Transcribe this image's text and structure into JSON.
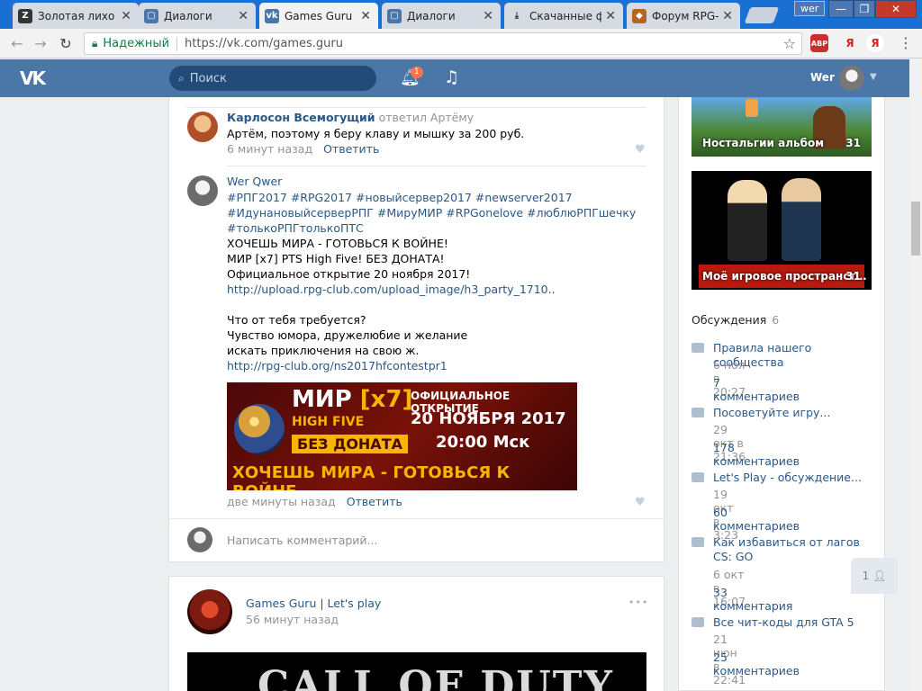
{
  "browser": {
    "tabs": [
      {
        "label": "Золотая лихо",
        "icon": "z-icon",
        "active": false
      },
      {
        "label": "Диалоги",
        "icon": "vk-chat-icon",
        "active": false
      },
      {
        "label": "Games Guru |",
        "icon": "vk-icon",
        "active": true
      },
      {
        "label": "Диалоги",
        "icon": "vk-chat-icon",
        "active": false
      },
      {
        "label": "Скачанные ф",
        "icon": "download-icon",
        "active": false
      },
      {
        "label": "Форум RPG-C",
        "icon": "forum-icon",
        "active": false
      }
    ],
    "profile_name": "wer",
    "secure_label": "Надежный",
    "url": "https://vk.com/games.guru",
    "extensions": [
      {
        "label": "ABP",
        "sub": "2"
      },
      {
        "label": "Я"
      },
      {
        "label": "Я"
      }
    ]
  },
  "vk_header": {
    "logo": "VK",
    "search_placeholder": "Поиск",
    "notifications_count": "1",
    "user_name": "Wer"
  },
  "comments": [
    {
      "author": "Карлосон Всемогущий",
      "replied": "ответил Артёму",
      "text": "Артём, поэтому я беру клаву и мышку за 200 руб.",
      "time": "6 минут назад",
      "reply_label": "Ответить"
    },
    {
      "author": "Wer Qwer",
      "hashtags_line1": "#РПГ2017 #RPG2017 #новыйсервер2017 #newserver2017",
      "hashtags_line2": "#ИдунановыйсерверРПГ #МируМИР #RPGonelove #люблюРПГшечку",
      "hashtags_line3": "#толькоРПГтолькоПТС",
      "line1": "ХОЧЕШЬ МИРА - ГОТОВЬСЯ К ВОЙНЕ!",
      "line2": "МИР [x7] PTS High Five! БЕЗ ДОНАТА!",
      "line3": "Официальное открытие 20 ноября 2017!",
      "link1": "http://upload.rpg-club.com/upload_image/h3_party_1710..",
      "line4": "Что от тебя требуется?",
      "line5": "Чувство юмора, дружелюбие и желание",
      "line6": "искать приключения на свою ж.",
      "link2": "http://rpg-club.org/ns2017hfcontestpr1",
      "time": "две минуты назад",
      "reply_label": "Ответить"
    }
  ],
  "banner": {
    "title_main": "МИР",
    "title_rate": "[x7]",
    "subtitle": "HIGH FIVE",
    "no_donate": "БЕЗ ДОНАТА",
    "opening": "ОФИЦИАЛЬНОЕ ОТКРЫТИЕ",
    "date": "20 НОЯБРЯ 2017",
    "time": "20:00 Мск",
    "slogan": "ХОЧЕШЬ МИРА - ГОТОВЬСЯ К ВОЙНЕ"
  },
  "write_comment_placeholder": "Написать комментарий...",
  "post": {
    "author": "Games Guru | Let's play",
    "time": "56 минут назад",
    "menu": "•••",
    "image_text": "CALL OF DUTY"
  },
  "albums": [
    {
      "title": "Ностальгии альбом",
      "count": "31"
    },
    {
      "title": "Моё игровое пространст…",
      "count": "31"
    }
  ],
  "discussions": {
    "title": "Обсуждения",
    "count": "6",
    "items": [
      {
        "title": "Правила нашего сообщества",
        "date": "6 ноя в 20:27",
        "comments": "7 комментариев"
      },
      {
        "title": "Посоветуйте игру...",
        "date": "29 окт в 21:36",
        "comments": "178 комментариев"
      },
      {
        "title": "Let's Play - обсуждение...",
        "date": "19 окт в 3:23",
        "comments": "60 комментариев"
      },
      {
        "title": "Как избавиться от лагов CS: GO",
        "date": "6 окт в 16:07",
        "comments": "33 комментария"
      },
      {
        "title": "Все чит-коды для GTA 5",
        "date": "21 июн в 22:41",
        "comments": "25 комментариев"
      }
    ]
  },
  "chat_online": "1"
}
